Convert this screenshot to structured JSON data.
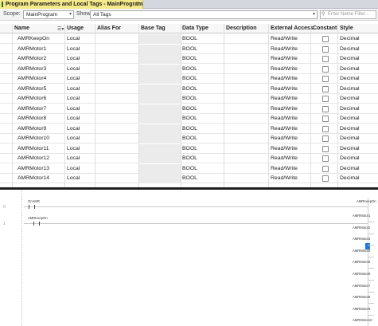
{
  "tab": {
    "title": "Program Parameters and Local Tags - MainProgram",
    "close": "×"
  },
  "toolbar": {
    "scope_label": "Scope:",
    "scope_value": "MainProgram",
    "show_label": "Show:",
    "show_value": "All Tags",
    "filter_placeholder": "Enter Name Filter..."
  },
  "grid": {
    "columns": [
      "Name",
      "Usage",
      "Alias For",
      "Base Tag",
      "Data Type",
      "Description",
      "External Access",
      "Constant",
      "Style"
    ],
    "rows": [
      {
        "name": "AMRKeepOn",
        "usage": "Local",
        "alias": "",
        "base": "",
        "type": "BOOL",
        "desc": "",
        "access": "Read/Write",
        "constant": false,
        "style": "Decimal"
      },
      {
        "name": "AMRMotor1",
        "usage": "Local",
        "alias": "",
        "base": "",
        "type": "BOOL",
        "desc": "",
        "access": "Read/Write",
        "constant": false,
        "style": "Decimal"
      },
      {
        "name": "AMRMotor2",
        "usage": "Local",
        "alias": "",
        "base": "",
        "type": "BOOL",
        "desc": "",
        "access": "Read/Write",
        "constant": false,
        "style": "Decimal"
      },
      {
        "name": "AMRMotor3",
        "usage": "Local",
        "alias": "",
        "base": "",
        "type": "BOOL",
        "desc": "",
        "access": "Read/Write",
        "constant": false,
        "style": "Decimal"
      },
      {
        "name": "AMRMotor4",
        "usage": "Local",
        "alias": "",
        "base": "",
        "type": "BOOL",
        "desc": "",
        "access": "Read/Write",
        "constant": false,
        "style": "Decimal"
      },
      {
        "name": "AMRMotor5",
        "usage": "Local",
        "alias": "",
        "base": "",
        "type": "BOOL",
        "desc": "",
        "access": "Read/Write",
        "constant": false,
        "style": "Decimal"
      },
      {
        "name": "AMRMotor6",
        "usage": "Local",
        "alias": "",
        "base": "",
        "type": "BOOL",
        "desc": "",
        "access": "Read/Write",
        "constant": false,
        "style": "Decimal"
      },
      {
        "name": "AMRMotor7",
        "usage": "Local",
        "alias": "",
        "base": "",
        "type": "BOOL",
        "desc": "",
        "access": "Read/Write",
        "constant": false,
        "style": "Decimal"
      },
      {
        "name": "AMRMotor8",
        "usage": "Local",
        "alias": "",
        "base": "",
        "type": "BOOL",
        "desc": "",
        "access": "Read/Write",
        "constant": false,
        "style": "Decimal"
      },
      {
        "name": "AMRMotor9",
        "usage": "Local",
        "alias": "",
        "base": "",
        "type": "BOOL",
        "desc": "",
        "access": "Read/Write",
        "constant": false,
        "style": "Decimal"
      },
      {
        "name": "AMRMotor10",
        "usage": "Local",
        "alias": "",
        "base": "",
        "type": "BOOL",
        "desc": "",
        "access": "Read/Write",
        "constant": false,
        "style": "Decimal"
      },
      {
        "name": "AMRMotor11",
        "usage": "Local",
        "alias": "",
        "base": "",
        "type": "BOOL",
        "desc": "",
        "access": "Read/Write",
        "constant": false,
        "style": "Decimal"
      },
      {
        "name": "AMRMotor12",
        "usage": "Local",
        "alias": "",
        "base": "",
        "type": "BOOL",
        "desc": "",
        "access": "Read/Write",
        "constant": false,
        "style": "Decimal"
      },
      {
        "name": "AMRMotor13",
        "usage": "Local",
        "alias": "",
        "base": "",
        "type": "BOOL",
        "desc": "",
        "access": "Read/Write",
        "constant": false,
        "style": "Decimal"
      },
      {
        "name": "AMRMotor14",
        "usage": "Local",
        "alias": "",
        "base": "",
        "type": "BOOL",
        "desc": "",
        "access": "Read/Write",
        "constant": false,
        "style": "Decimal"
      }
    ]
  },
  "ladder": {
    "rung0_contact": "OnAMR",
    "rung0_coil": "AMRKeepOn",
    "rung1_contact": "AMRKeepOn",
    "rung1_coils": [
      "AMRMotor1",
      "AMRMotor2",
      "AMRMotor3",
      "AMRMotor4",
      "AMRMotor5",
      "AMRMotor6",
      "AMRMotor7",
      "AMRMotor8",
      "AMRMotor9",
      "AMRMotor10"
    ]
  }
}
